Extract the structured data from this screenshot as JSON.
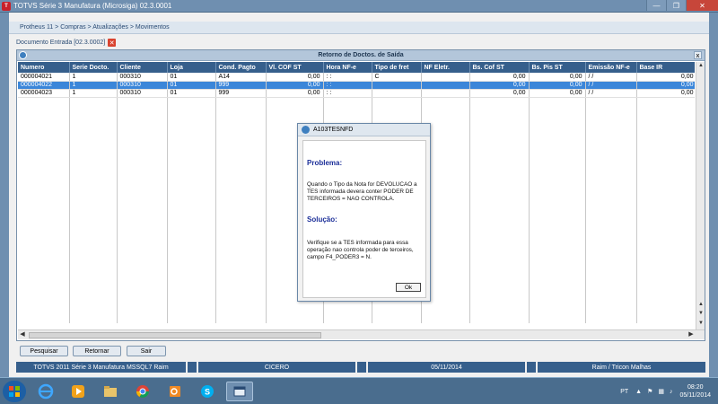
{
  "window": {
    "title": "TOTVS Série 3 Manufatura (Microsiga) 02.3.0001",
    "minimize": "—",
    "maximize": "❐",
    "close": "✕"
  },
  "breadcrumb": "Protheus 11 > Compras > Atualizações > Movimentos",
  "doc_tab": {
    "label": "Documento Entrada [02.3.0002]",
    "close": "✕"
  },
  "panel": {
    "title": "Retorno de Doctos. de Saída",
    "close": "x"
  },
  "table": {
    "columns": [
      "Numero",
      "Serie Docto.",
      "Cliente",
      "Loja",
      "Cond. Pagto",
      "Vl. COF ST",
      "Hora NF-e",
      "Tipo de fret",
      "NF Eletr.",
      "Bs. Cof ST",
      "Bs. Pis ST",
      "Emissão NF-e",
      "Base IR"
    ],
    "rows": [
      [
        "000004021",
        "1",
        "000310",
        "01",
        "A14",
        "0,00",
        ": :",
        "C",
        "",
        "0,00",
        "0,00",
        " /  /",
        "0,00"
      ],
      [
        "000004022",
        "1",
        "000310",
        "01",
        "999",
        "0,00",
        ": :",
        "",
        "",
        "0,00",
        "0,00",
        " /  /",
        "0,00"
      ],
      [
        "000004023",
        "1",
        "000310",
        "01",
        "999",
        "0,00",
        ": :",
        "",
        "",
        "0,00",
        "0,00",
        " /  /",
        "0,00"
      ]
    ],
    "selected_row": 1
  },
  "buttons": {
    "pesquisar": "Pesquisar",
    "retornar": "Retornar",
    "sair": "Sair"
  },
  "statusbar": [
    "TOTVS 2011 Série 3 Manufatura MSSQL7 Raim",
    "",
    "CICERO",
    "",
    "05/11/2014",
    "",
    "Raim / Tricon Malhas"
  ],
  "modal": {
    "title": "A103TESNFD",
    "problem_heading": "Problema:",
    "problem_text": "Quando o Tipo da Nota for DEVOLUCAO a TES informada devera conter PODER DE TERCEIROS = NAO CONTROLA.",
    "solution_heading": "Solução:",
    "solution_text": "Verifique se a TES informada para essa operação nao controla poder de terceiros, campo F4_PODER3 = N.",
    "ok": "Ok"
  },
  "taskbar": {
    "lang": "PT",
    "time": "08:20",
    "date": "05/11/2014",
    "apps": [
      "internet-explorer-icon",
      "media-player-icon",
      "file-explorer-icon",
      "chrome-icon",
      "outlook-icon",
      "skype-icon",
      "protheus-icon"
    ]
  },
  "colors": {
    "header_blue": "#365f8c",
    "selected_row": "#3b86d9",
    "heading_blue": "#1c2f99"
  }
}
